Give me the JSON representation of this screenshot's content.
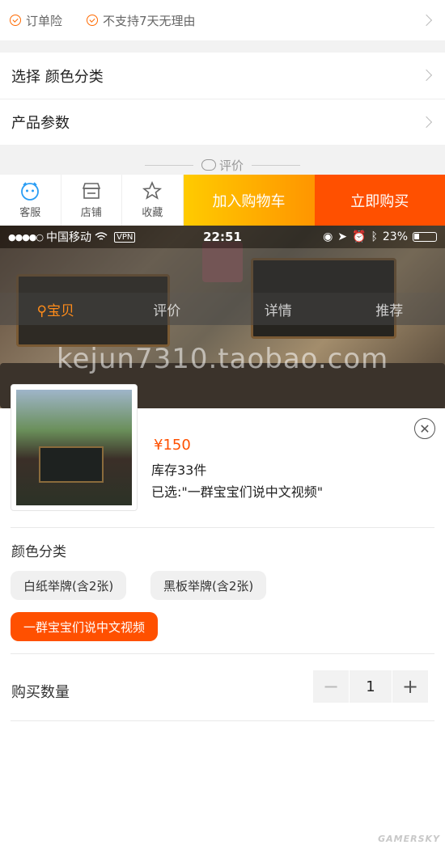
{
  "guarantees": [
    "订单险",
    "不支持7天无理由"
  ],
  "rows": {
    "select": "选择  颜色分类",
    "params": "产品参数"
  },
  "review_divider": "评价",
  "action_bar": {
    "service": "客服",
    "shop": "店铺",
    "favorite": "收藏",
    "add_to_cart": "加入购物车",
    "buy_now": "立即购买"
  },
  "status_bar": {
    "carrier": "中国移动",
    "vpn": "VPN",
    "time": "22:51",
    "battery": "23%"
  },
  "photo_tabs": [
    "宝贝",
    "评价",
    "详情",
    "推荐"
  ],
  "watermark": "kejun7310.taobao.com",
  "sku": {
    "price": "¥150",
    "stock": "库存33件",
    "selected": "已选:\"一群宝宝们说中文视频\"",
    "color_label": "颜色分类",
    "options": [
      "白纸举牌(含2张)",
      "黑板举牌(含2张)",
      "一群宝宝们说中文视频"
    ],
    "selected_option_index": 2,
    "quantity_label": "购买数量",
    "quantity": "1",
    "minus": "−",
    "plus": "+"
  },
  "credit": "GAMERSKY",
  "colors": {
    "accent": "#ff5000",
    "cart_gradient": [
      "#ffcb00",
      "#ff9500"
    ],
    "active_tab": "#ff8c1a"
  }
}
